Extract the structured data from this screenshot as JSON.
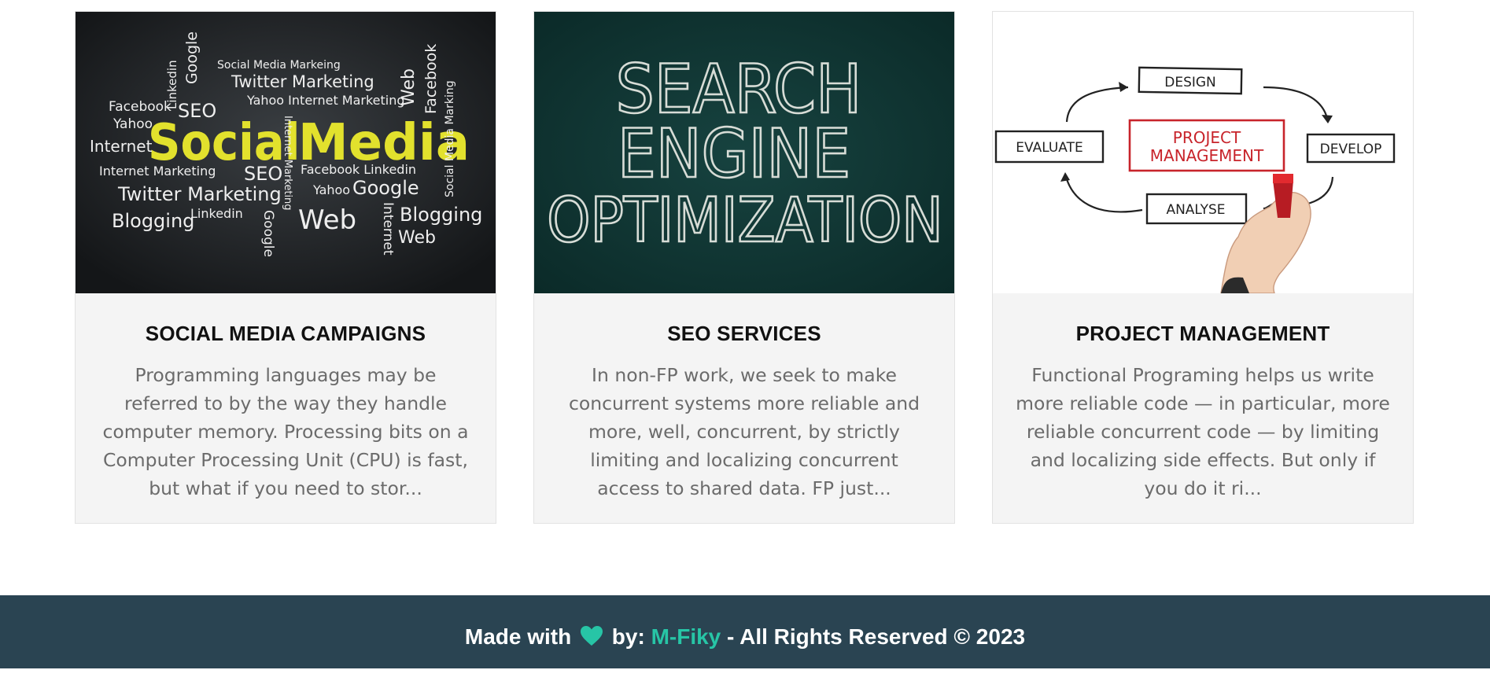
{
  "cards": [
    {
      "title": "SOCIAL MEDIA CAMPAIGNS",
      "text": "Programming languages may be referred to by the way they handle computer memory. Processing bits on a Computer Processing Unit (CPU) is fast, but what if you need to stor...",
      "image": {
        "words": [
          "Social",
          "Media",
          "Twitter Marketing",
          "Social Media Markeing",
          "Yahoo Internet Marketing",
          "Facebook",
          "Yahoo",
          "Internet",
          "SEO",
          "Linkedin",
          "Google",
          "Web",
          "Facebook",
          "Social Media Marking",
          "Internet Marketing",
          "SEO",
          "Facebook Linkedin",
          "Yahoo",
          "Google",
          "Twitter Marketing",
          "Blogging",
          "Linkedin",
          "Web",
          "Internet Marketing",
          "Google",
          "Internet",
          "Blogging",
          "Web"
        ],
        "colors": {
          "background": "#1e2124",
          "highlight": "#e2e12d",
          "text": "#e8e8e8"
        }
      }
    },
    {
      "title": "SEO SERVICES",
      "text": "In non-FP work, we seek to make concurrent systems more reliable and more, well, concurrent, by strictly limiting and localizing concurrent access to shared data. FP just...",
      "image": {
        "lines": [
          "SEARCH",
          "ENGINE",
          "OPTIMIZATION"
        ],
        "colors": {
          "background": "#0f3533",
          "text": "#d7dcd6"
        }
      }
    },
    {
      "title": "PROJECT MANAGEMENT",
      "text": "Functional Programing helps us write more reliable code — in particular, more reliable concurrent code — by limiting and localizing side effects. But only if you do it ri...",
      "image": {
        "center_line1": "PROJECT",
        "center_line2": "MANAGEMENT",
        "steps": [
          "DESIGN",
          "DEVELOP",
          "ANALYSE",
          "EVALUATE"
        ],
        "colors": {
          "background": "#ffffff",
          "center": "#c8242b",
          "ink": "#222222"
        }
      }
    }
  ],
  "footer": {
    "made_with": "Made with",
    "heart_icon": "heart-icon",
    "by": "by:",
    "author": "M-Fiky",
    "rights": "- All Rights Reserved © 2023",
    "colors": {
      "background": "#2a4452",
      "accent": "#27c5a6"
    }
  }
}
